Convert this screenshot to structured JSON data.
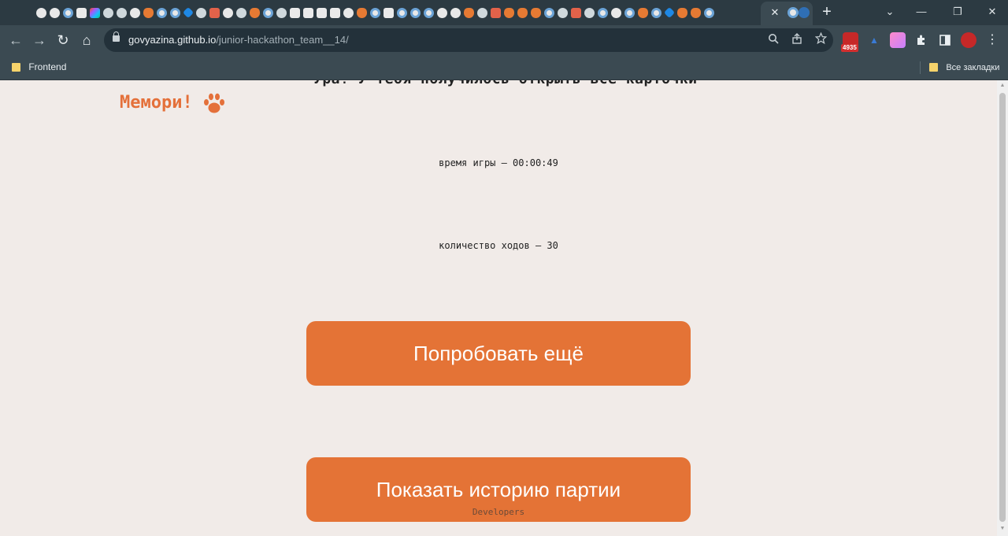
{
  "browser": {
    "active_tab_close": "✕",
    "new_tab": "+",
    "window_controls": {
      "dropdown": "⌄",
      "minimize": "—",
      "restore": "❐",
      "close": "✕"
    },
    "toolbar": {
      "back": "←",
      "forward": "→",
      "reload": "↻",
      "home": "⌂"
    },
    "address": {
      "host": "govyazina.github.io",
      "path": "/junior-hackathon_team__14/"
    },
    "extension_badge": "4935",
    "bookmarks": {
      "left_label": "Frontend",
      "right_label": "Все закладки"
    },
    "menu": "⋮"
  },
  "page": {
    "cutoff_heading": "Ура! У тебя получилось открыть все карточки",
    "logo_text": "Мемори!",
    "game_time": "время игры – 00:00:49",
    "move_count": "количество ходов – 30",
    "retry_button": "Попробовать ещё",
    "history_button": "Показать историю партии",
    "footer_link": "Developers"
  },
  "colors": {
    "accent": "#e47336",
    "page_bg": "#f1ebe8",
    "chrome_dark": "#2c3a42",
    "chrome_toolbar": "#3b4a52"
  },
  "icons": {
    "tab_favicons": "mixed-favicons-row",
    "logo_icon": "paw-icon",
    "search_in_page": "magnifier-icon",
    "share": "share-icon",
    "bookmark_star": "star-icon",
    "extensions": "puzzle-icon",
    "side_panel": "side-panel-icon",
    "profile": "avatar-icon"
  }
}
